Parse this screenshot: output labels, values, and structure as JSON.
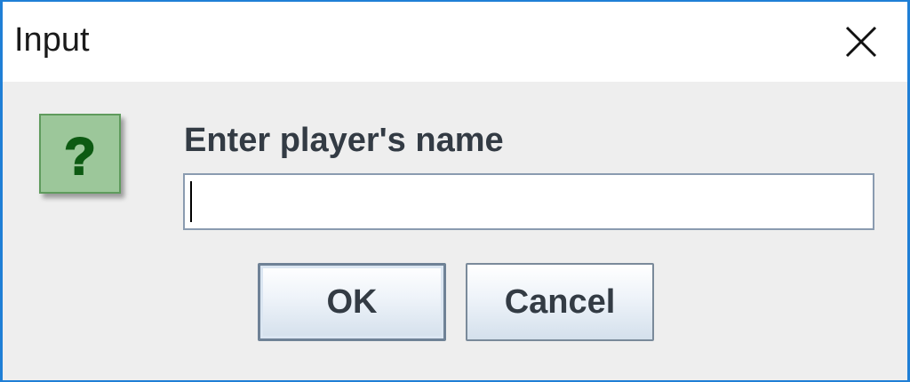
{
  "dialog": {
    "title": "Input",
    "prompt": "Enter player's name",
    "input_value": "",
    "icon": "question-icon"
  },
  "buttons": {
    "ok_label": "OK",
    "cancel_label": "Cancel"
  },
  "colors": {
    "window_border": "#1f7fd6",
    "icon_background": "#9cc79a",
    "icon_glyph": "#0d5a12"
  }
}
